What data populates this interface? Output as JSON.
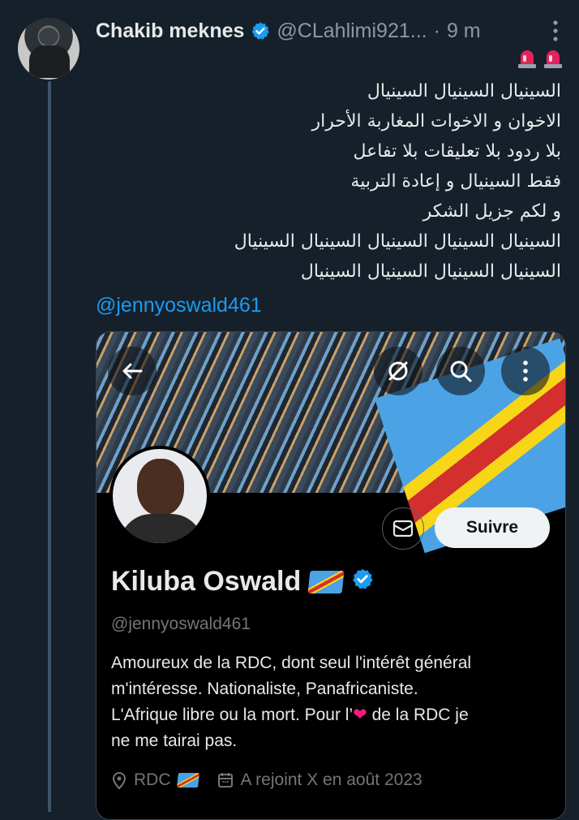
{
  "tweet": {
    "author_name": "Chakib meknes",
    "author_handle": "@CLahlimi921...",
    "separator": "·",
    "time": "9 m",
    "emojis": [
      "rotating-light-icon",
      "rotating-light-icon"
    ],
    "lines": [
      "السينيال السينيال السينيال",
      "الاخوان و الاخوات المغاربة الأحرار",
      "بلا ردود بلا تعليقات بلا تفاعل",
      "فقط السينيال و إعادة التربية",
      "و لكم جزيل الشكر",
      "السينيال السينيال السينيال السينيال السينيال",
      "السينيال السينيال السينيال السينيال"
    ],
    "mention": "@jennyoswald461"
  },
  "profile": {
    "name": "Kiluba Oswald",
    "handle": "@jennyoswald461",
    "follow_label": "Suivre",
    "bio_line1": "Amoureux de la RDC, dont seul l'intérêt général",
    "bio_line2": "m'intéresse. Nationaliste, Panafricaniste.",
    "bio_line3_a": "L'Afrique libre ou la mort. Pour l’",
    "bio_heart": "❤",
    "bio_line3_b": " de la RDC je",
    "bio_line4": "ne me tairai pas.",
    "location": "RDC",
    "joined": "A rejoint X en août 2023"
  },
  "colors": {
    "background": "#15202b",
    "accent": "#1d9bf0",
    "muted": "#8b98a5"
  }
}
